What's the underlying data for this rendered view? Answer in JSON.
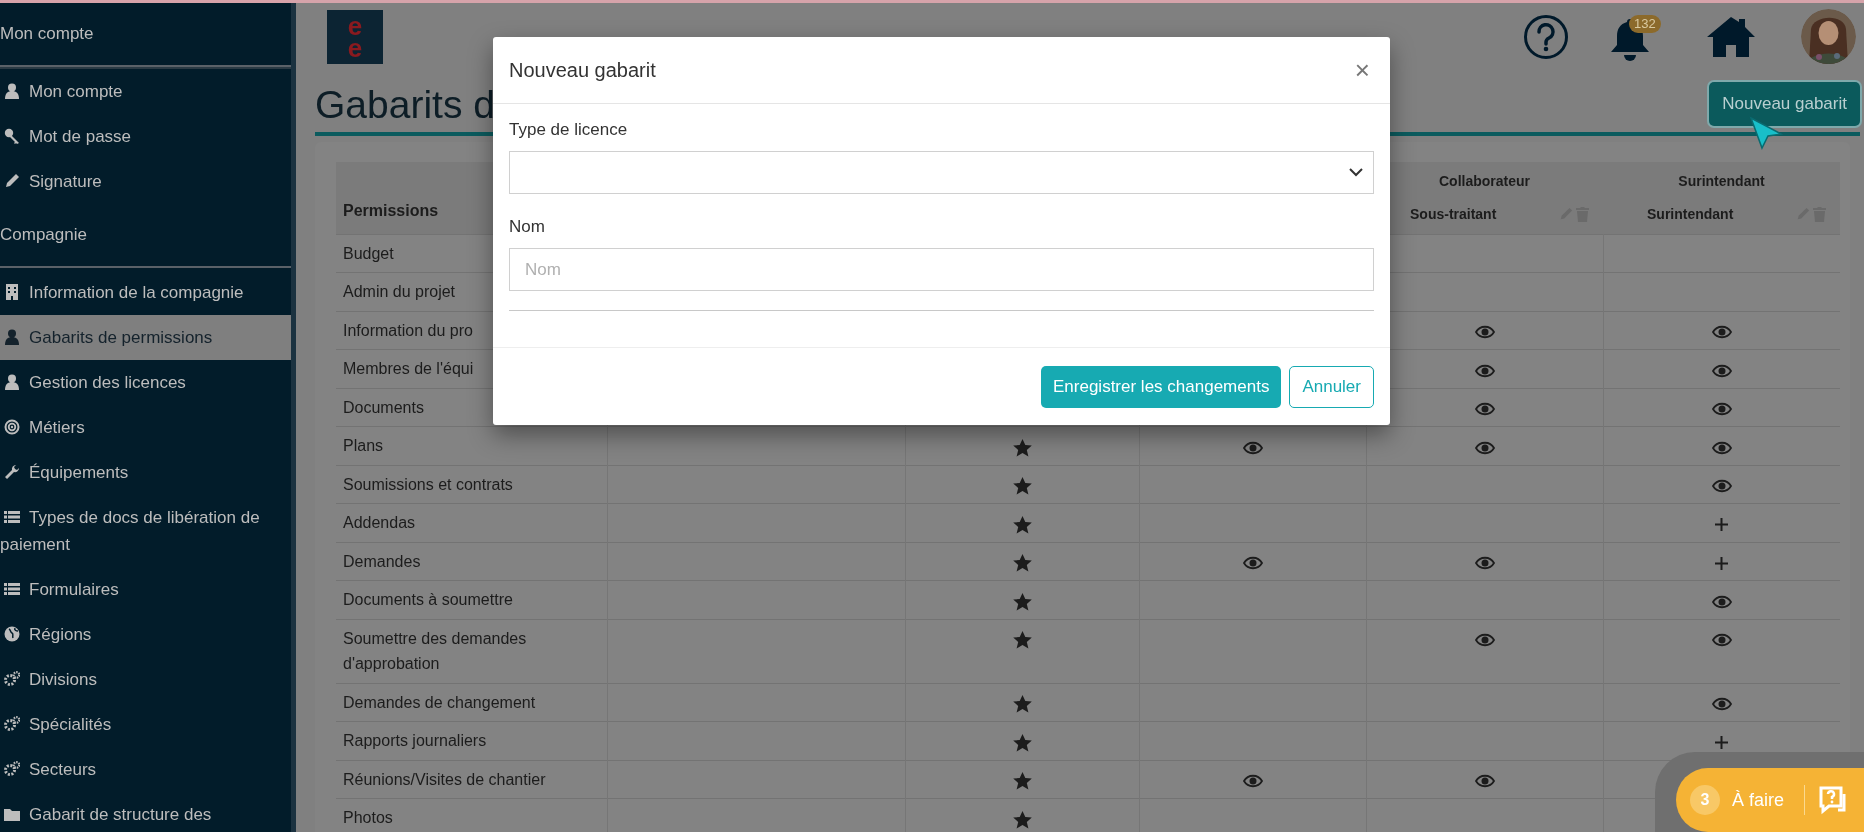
{
  "sidebar": {
    "sections": [
      {
        "title": "Mon compte",
        "items": [
          {
            "label": "Mon compte",
            "selected": false
          },
          {
            "label": "Mot de passe",
            "selected": false
          },
          {
            "label": "Signature",
            "selected": false
          }
        ]
      },
      {
        "title": "Compagnie",
        "items": [
          {
            "label": "Information de la compagnie",
            "selected": false
          },
          {
            "label": "Gabarits de permissions",
            "selected": true
          },
          {
            "label": "Gestion des licences",
            "selected": false
          },
          {
            "label": "Métiers",
            "selected": false
          },
          {
            "label": "Équipements",
            "selected": false
          },
          {
            "label": "Types de docs de libération de paiement",
            "selected": false
          },
          {
            "label": "Formulaires",
            "selected": false
          },
          {
            "label": "Régions",
            "selected": false
          },
          {
            "label": "Divisions",
            "selected": false
          },
          {
            "label": "Spécialités",
            "selected": false
          },
          {
            "label": "Secteurs",
            "selected": false
          },
          {
            "label": "Gabarit de structure des",
            "selected": false
          }
        ]
      }
    ]
  },
  "header": {
    "logo_letters": [
      "e",
      "e"
    ],
    "notifications": "132"
  },
  "page": {
    "title": "Gabarits d",
    "new_button": "Nouveau gabarit"
  },
  "table": {
    "first_column": "Permissions",
    "columns": [
      null,
      null,
      null,
      {
        "title": "Collaborateur",
        "subtitle": "Sous-traitant"
      },
      {
        "title": "Surintendant",
        "subtitle": "Surintendant"
      }
    ],
    "rows": [
      {
        "label": "Budget",
        "cells": [
          null,
          null,
          null,
          null,
          null
        ]
      },
      {
        "label": "Admin du projet",
        "cells": [
          null,
          null,
          null,
          null,
          null
        ]
      },
      {
        "label": "Information du pro",
        "cells": [
          null,
          null,
          null,
          {
            "kind": "eye"
          },
          {
            "kind": "eye"
          }
        ]
      },
      {
        "label": "Membres de l'équi",
        "cells": [
          null,
          null,
          null,
          {
            "kind": "eye"
          },
          {
            "kind": "eye"
          }
        ]
      },
      {
        "label": "Documents",
        "cells": [
          null,
          null,
          null,
          {
            "kind": "eye"
          },
          {
            "kind": "eye"
          }
        ]
      },
      {
        "label": "Plans",
        "cells": [
          null,
          {
            "kind": "star"
          },
          {
            "kind": "eye"
          },
          {
            "kind": "eye"
          },
          {
            "kind": "eye"
          }
        ]
      },
      {
        "label": "Soumissions et contrats",
        "cells": [
          null,
          {
            "kind": "star"
          },
          null,
          null,
          {
            "kind": "eye"
          }
        ]
      },
      {
        "label": "Addendas",
        "cells": [
          null,
          {
            "kind": "star"
          },
          null,
          null,
          {
            "kind": "plus"
          }
        ]
      },
      {
        "label": "Demandes",
        "cells": [
          null,
          {
            "kind": "star"
          },
          {
            "kind": "eye"
          },
          {
            "kind": "eye"
          },
          {
            "kind": "plus"
          }
        ]
      },
      {
        "label": "Documents à soumettre",
        "cells": [
          null,
          {
            "kind": "star"
          },
          null,
          null,
          {
            "kind": "eye"
          }
        ]
      },
      {
        "label": "Soumettre des demandes d'approbation",
        "cells": [
          null,
          {
            "kind": "star"
          },
          null,
          {
            "kind": "eye"
          },
          {
            "kind": "eye"
          }
        ]
      },
      {
        "label": "Demandes de changement",
        "cells": [
          null,
          {
            "kind": "star"
          },
          null,
          null,
          {
            "kind": "eye"
          }
        ]
      },
      {
        "label": "Rapports journaliers",
        "cells": [
          null,
          {
            "kind": "star"
          },
          null,
          null,
          {
            "kind": "plus"
          }
        ]
      },
      {
        "label": "Réunions/Visites de chantier",
        "cells": [
          null,
          {
            "kind": "star"
          },
          {
            "kind": "eye"
          },
          {
            "kind": "eye"
          },
          null
        ]
      },
      {
        "label": "Photos",
        "cells": [
          null,
          {
            "kind": "star"
          },
          null,
          null,
          null
        ]
      }
    ]
  },
  "modal": {
    "title": "Nouveau gabarit",
    "close": "×",
    "fields": [
      {
        "kind": "select",
        "label": "Type de licence"
      },
      {
        "kind": "text",
        "label": "Nom",
        "placeholder": "Nom"
      }
    ],
    "buttons": [
      {
        "kind": "primary",
        "label": "Enregistrer les changements"
      },
      {
        "kind": "secondary",
        "label": "Annuler"
      }
    ]
  },
  "todo": {
    "count": "3",
    "label": "À faire"
  }
}
